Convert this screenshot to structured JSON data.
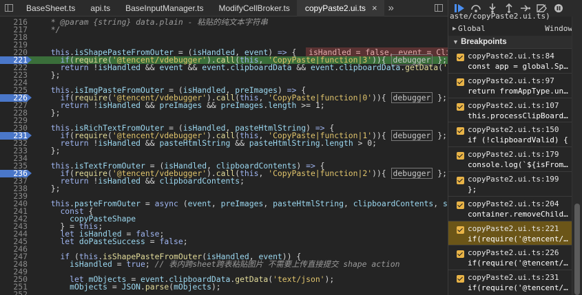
{
  "tabs": [
    {
      "label": "BaseSheet.ts",
      "active": false
    },
    {
      "label": "api.ts",
      "active": false
    },
    {
      "label": "BaseInputManager.ts",
      "active": false
    },
    {
      "label": "ModifyCellBroker.ts",
      "active": false
    },
    {
      "label": "copyPaste2.ui.ts",
      "active": true,
      "close": "×"
    }
  ],
  "more_tabs": "»",
  "code_lines": [
    {
      "n": "216",
      "html": "<span class='cm'>  * @param {string} data.plain - 粘贴的纯文本字符串</span>"
    },
    {
      "n": "217",
      "html": "<span class='cm'>  */</span>"
    },
    {
      "n": "218",
      "html": ""
    },
    {
      "n": "219",
      "html": ""
    },
    {
      "n": "220",
      "html": "  <span class='kw'>this</span>.<span class='var'>isShapePasteFromOuter</span> = (<span class='var'>isHandled</span>, <span class='var'>event</span>) <span class='kw'>=&gt;</span> {  <span class='inline-val'>isHandled = false, event = Clipbo</span>"
    },
    {
      "n": "221",
      "html": "    <span class='kw'>if</span>(<span class='fn'>require</span>(<span class='str'>'@tencent/vdebugger'</span>).<span class='fn'>call</span>(<span class='kw'>this</span>, <span class='str'>'CopyPaste|function|3'</span>)){ <span class='dbg'>debugger</span> };"
    },
    {
      "n": "222",
      "html": "    <span class='kw'>return</span> !<span class='var'>isHandled</span> &amp;&amp; <span class='var'>event</span> &amp;&amp; <span class='var'>event</span>.<span class='var'>clipboardData</span> &amp;&amp; <span class='var'>event</span>.<span class='var'>clipboardData</span>.<span class='fn'>getData</span>(<span class='str'>'tex</span>"
    },
    {
      "n": "223",
      "html": "  };"
    },
    {
      "n": "224",
      "html": ""
    },
    {
      "n": "225",
      "html": "  <span class='kw'>this</span>.<span class='var'>isImgPasteFromOuter</span> = (<span class='var'>isHandled</span>, <span class='var'>preImages</span>) <span class='kw'>=&gt;</span> {"
    },
    {
      "n": "226",
      "html": "    <span class='kw'>if</span>(<span class='fn'>require</span>(<span class='str'>'@tencent/vdebugger'</span>).<span class='fn'>call</span>(<span class='kw'>this</span>, <span class='str'>'CopyPaste|function|0'</span>)){ <span class='dbg'>debugger</span> };"
    },
    {
      "n": "227",
      "html": "    <span class='kw'>return</span> !<span class='var'>isHandled</span> &amp;&amp; <span class='var'>preImages</span> &amp;&amp; <span class='var'>preImages</span>.<span class='var'>length</span> &gt;= 1;"
    },
    {
      "n": "228",
      "html": "  };"
    },
    {
      "n": "229",
      "html": ""
    },
    {
      "n": "230",
      "html": "  <span class='kw'>this</span>.<span class='var'>isRichTextFromOuter</span> = (<span class='var'>isHandled</span>, <span class='var'>pasteHtmlString</span>) <span class='kw'>=&gt;</span> {"
    },
    {
      "n": "231",
      "html": "    <span class='kw'>if</span>(<span class='fn'>require</span>(<span class='str'>'@tencent/vdebugger'</span>).<span class='fn'>call</span>(<span class='kw'>this</span>, <span class='str'>'CopyPaste|function|1'</span>)){ <span class='dbg'>debugger</span> };"
    },
    {
      "n": "232",
      "html": "    <span class='kw'>return</span> !<span class='var'>isHandled</span> &amp;&amp; <span class='var'>pasteHtmlString</span> &amp;&amp; <span class='var'>pasteHtmlString</span>.<span class='var'>length</span> &gt; 0;"
    },
    {
      "n": "233",
      "html": "  };"
    },
    {
      "n": "234",
      "html": ""
    },
    {
      "n": "235",
      "html": "  <span class='kw'>this</span>.<span class='var'>isTextFromOuter</span> = (<span class='var'>isHandled</span>, <span class='var'>clipboardContents</span>) <span class='kw'>=&gt;</span> {"
    },
    {
      "n": "236",
      "html": "    <span class='kw'>if</span>(<span class='fn'>require</span>(<span class='str'>'@tencent/vdebugger'</span>).<span class='fn'>call</span>(<span class='kw'>this</span>, <span class='str'>'CopyPaste|function|2'</span>)){ <span class='dbg'>debugger</span> };"
    },
    {
      "n": "237",
      "html": "    <span class='kw'>return</span> !<span class='var'>isHandled</span> &amp;&amp; <span class='var'>clipboardContents</span>;"
    },
    {
      "n": "238",
      "html": "  };"
    },
    {
      "n": "239",
      "html": ""
    },
    {
      "n": "240",
      "html": "  <span class='kw'>this</span>.<span class='var'>pasteFromOuter</span> = <span class='kw'>async</span> (<span class='var'>event</span>, <span class='var'>preImages</span>, <span class='var'>pasteHtmlString</span>, <span class='var'>clipboardContents</span>, <span class='var'>sele</span>"
    },
    {
      "n": "241",
      "html": "    <span class='kw'>const</span> {"
    },
    {
      "n": "242",
      "html": "      <span class='var'>copyPasteShape</span>"
    },
    {
      "n": "243",
      "html": "    } = <span class='kw'>this</span>;"
    },
    {
      "n": "244",
      "html": "    <span class='kw'>let</span> <span class='var'>isHandled</span> = <span class='kw'>false</span>;"
    },
    {
      "n": "245",
      "html": "    <span class='kw'>let</span> <span class='var'>doPasteSuccess</span> = <span class='kw'>false</span>;"
    },
    {
      "n": "246",
      "html": ""
    },
    {
      "n": "247",
      "html": "    <span class='kw'>if</span> (<span class='kw'>this</span>.<span class='fn'>isShapePasteFromOuter</span>(<span class='var'>isHandled</span>, <span class='var'>event</span>)) {"
    },
    {
      "n": "248",
      "html": "      <span class='var'>isHandled</span> = <span class='kw'>true</span>; <span class='cm'>// 表内跨sheet跨表粘贴图片 不需要上传直接提交 shape action</span>"
    },
    {
      "n": "249",
      "html": ""
    },
    {
      "n": "250",
      "html": "      <span class='kw'>let</span> <span class='var'>mObjects</span> = <span class='var'>event</span>.<span class='var'>clipboardData</span>.<span class='fn'>getData</span>(<span class='str'>'text/json'</span>);"
    },
    {
      "n": "251",
      "html": "      <span class='var'>mObjects</span> = <span class='var'>JSON</span>.<span class='fn'>parse</span>(<span class='var'>mObjects</span>);"
    },
    {
      "n": "252",
      "html": ""
    }
  ],
  "breakpoint_lines": [
    "221",
    "226",
    "231",
    "236"
  ],
  "current_line": "221",
  "scope": {
    "path_fragment": "aste/copyPaste2.ui.ts)",
    "global_label": "Global",
    "global_value": "Window"
  },
  "breakpoints_header": "Breakpoints",
  "breakpoints": [
    {
      "loc": "copyPaste2.ui.ts:84",
      "code": "const app = global.Sp…",
      "active": false
    },
    {
      "loc": "copyPaste2.ui.ts:97",
      "code": "return fromAppType.un…",
      "active": false
    },
    {
      "loc": "copyPaste2.ui.ts:107",
      "code": "this.processClipBoard…",
      "active": false
    },
    {
      "loc": "copyPaste2.ui.ts:150",
      "code": "if (!clipboardValid) {",
      "active": false
    },
    {
      "loc": "copyPaste2.ui.ts:179",
      "code": "console.log(`${isFrom…",
      "active": false
    },
    {
      "loc": "copyPaste2.ui.ts:199",
      "code": "};",
      "active": false
    },
    {
      "loc": "copyPaste2.ui.ts:204",
      "code": "container.removeChild…",
      "active": false
    },
    {
      "loc": "copyPaste2.ui.ts:221",
      "code": "if(require('@tencent/…",
      "active": true
    },
    {
      "loc": "copyPaste2.ui.ts:226",
      "code": "if(require('@tencent/…",
      "active": false
    },
    {
      "loc": "copyPaste2.ui.ts:231",
      "code": "if(require('@tencent/…",
      "active": false
    }
  ],
  "colors": {
    "editor_bg": "#242424",
    "breakpoint_blue": "#4a77c9",
    "current_line_green": "#3a6e3a",
    "active_breakpoint_bg": "#6b5518",
    "checkbox": "#e8b347"
  }
}
